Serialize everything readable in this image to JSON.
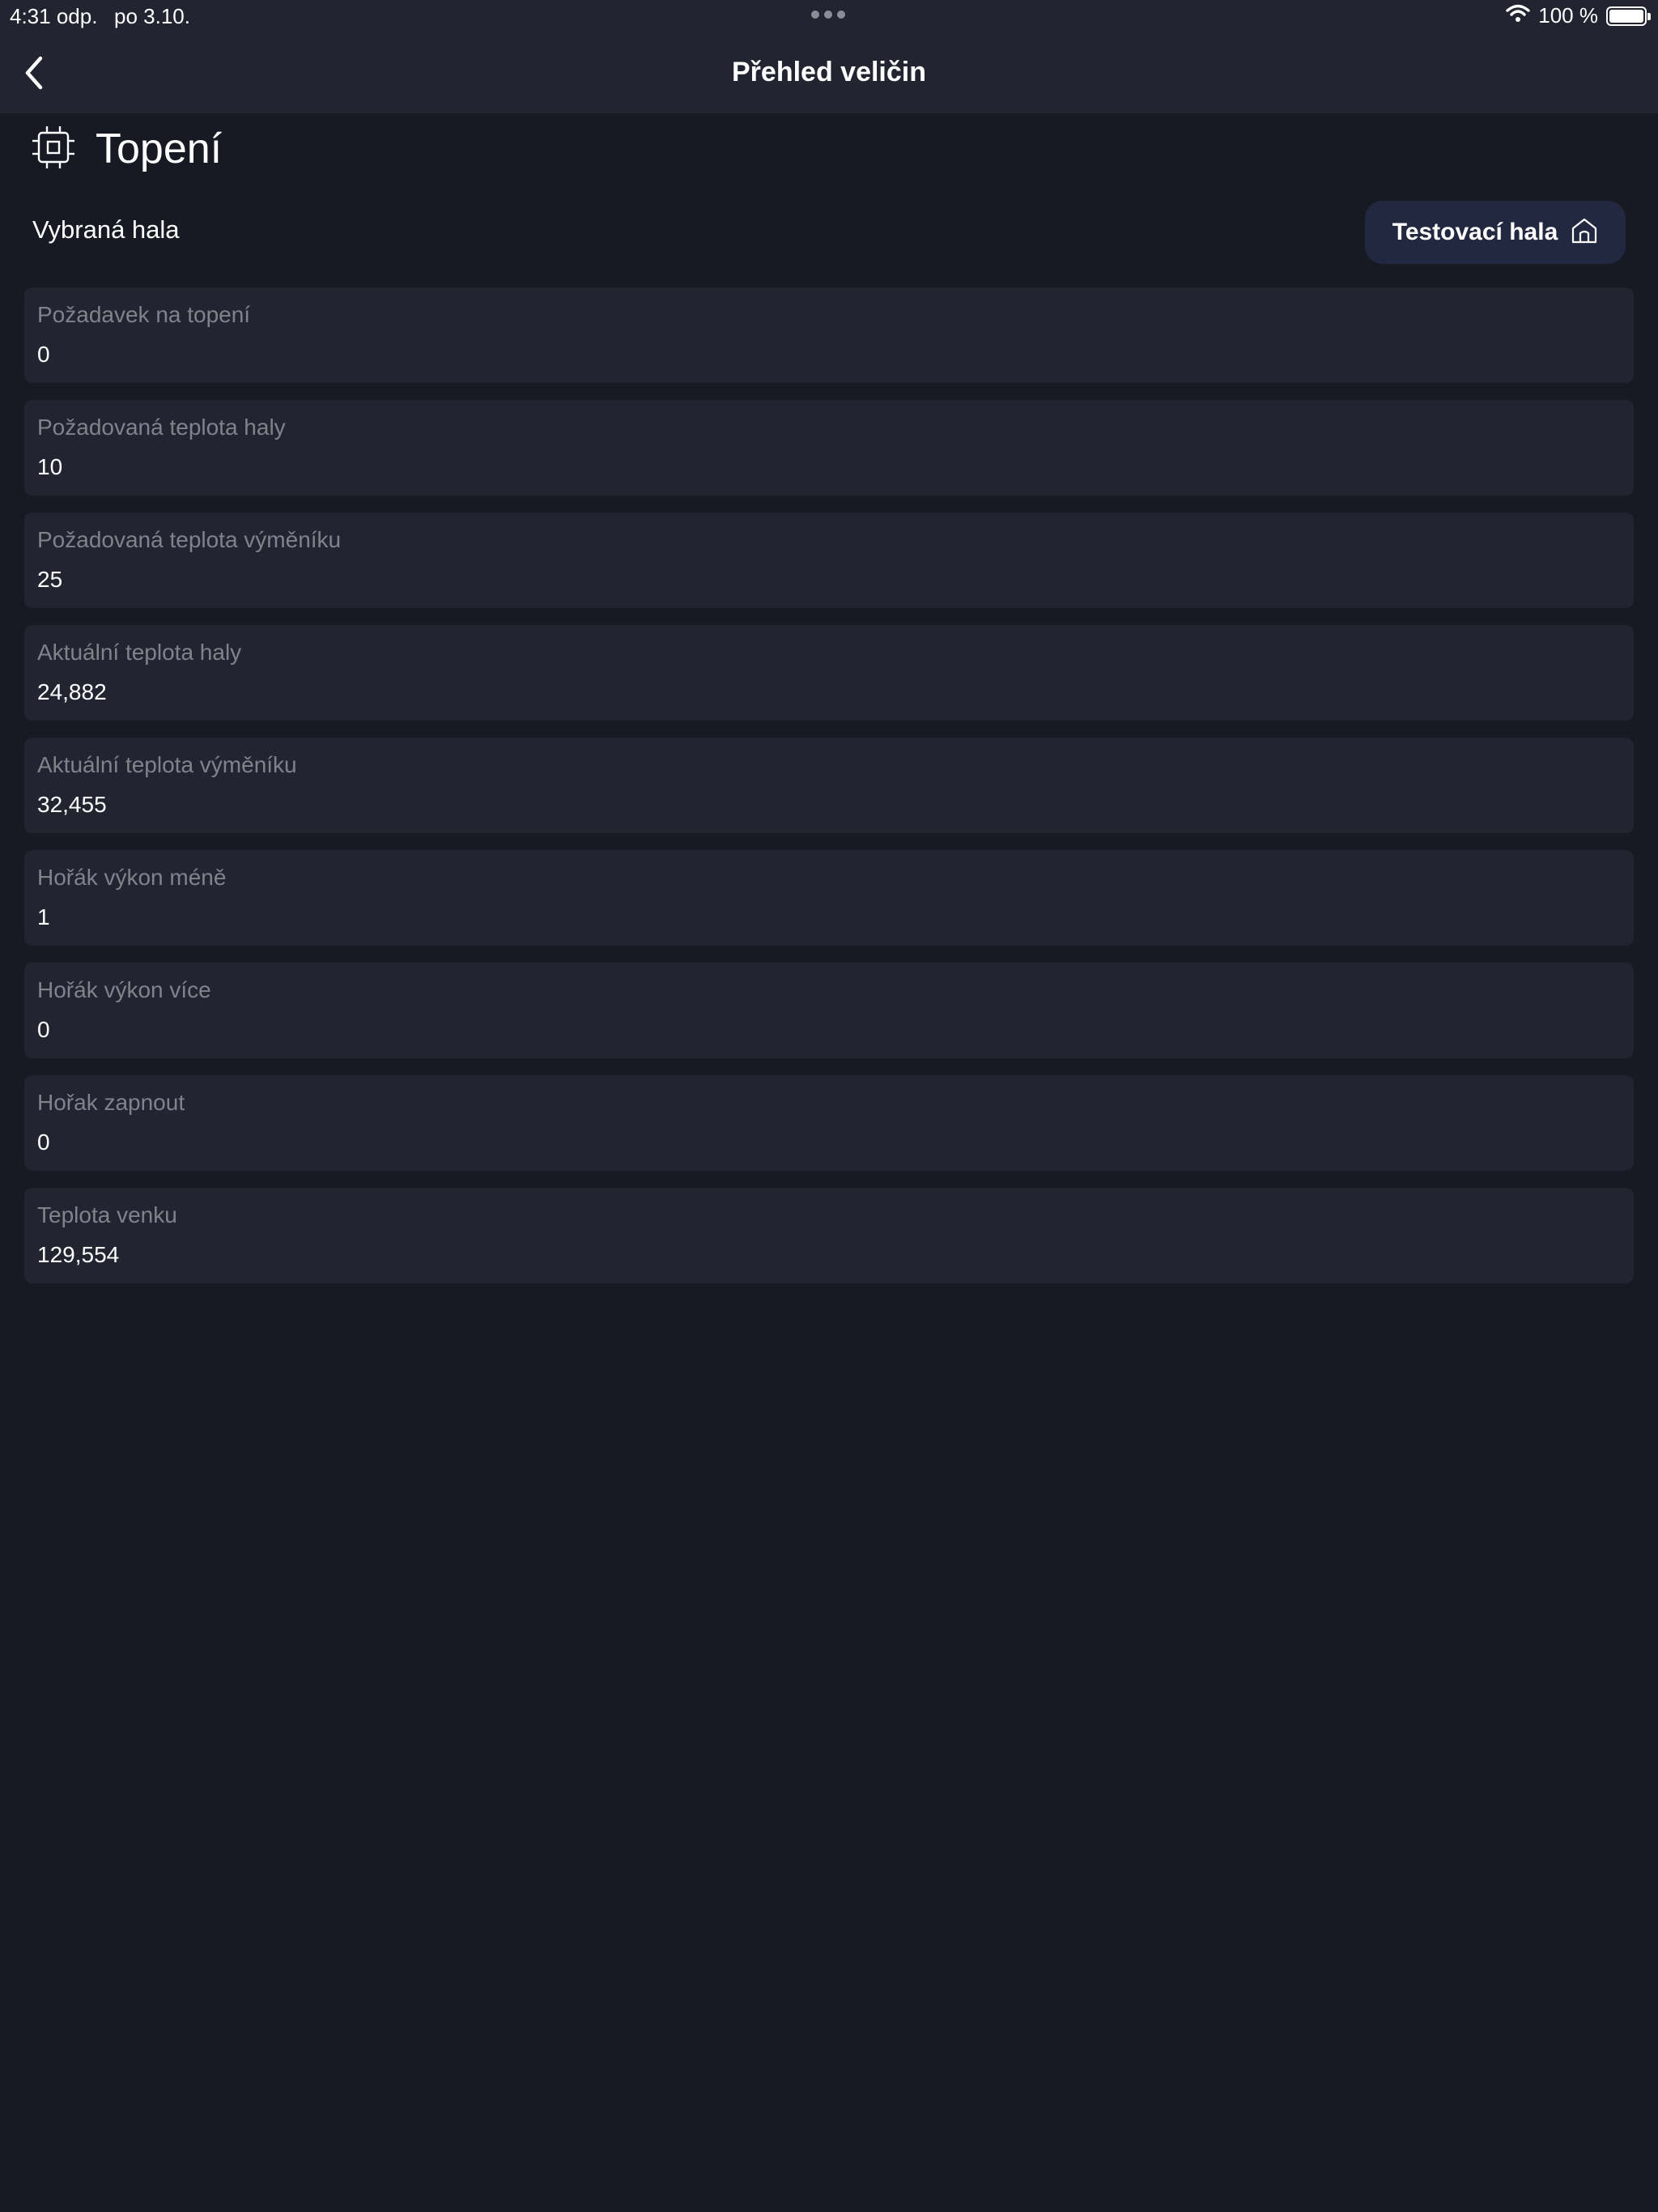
{
  "status_bar": {
    "time": "4:31 odp.",
    "date": "po 3.10.",
    "battery": "100 %",
    "battery_level": 1.0,
    "icons": [
      "wifi-icon",
      "battery-icon"
    ]
  },
  "nav": {
    "title": "Přehled veličin",
    "back_icon": "chevron-left-icon"
  },
  "section": {
    "title": "Topení",
    "icon": "chip-icon"
  },
  "hall": {
    "label": "Vybraná hala",
    "selected": "Testovací hala",
    "icon": "home-icon"
  },
  "cards": [
    {
      "label": "Požadavek na topení",
      "value": "0"
    },
    {
      "label": "Požadovaná teplota haly",
      "value": "10"
    },
    {
      "label": "Požadovaná teplota výměníku",
      "value": "25"
    },
    {
      "label": "Aktuální teplota haly",
      "value": "24,882"
    },
    {
      "label": "Aktuální teplota výměníku",
      "value": "32,455"
    },
    {
      "label": "Hořák výkon méně",
      "value": "1"
    },
    {
      "label": "Hořák výkon více",
      "value": "0"
    },
    {
      "label": "Hořak zapnout",
      "value": "0"
    },
    {
      "label": "Teplota venku",
      "value": "129,554"
    }
  ],
  "colors": {
    "background": "#171a23",
    "surface": "#222530",
    "hall_button": "#232841",
    "label_text": "#80838c",
    "value_text": "#ffffff"
  }
}
